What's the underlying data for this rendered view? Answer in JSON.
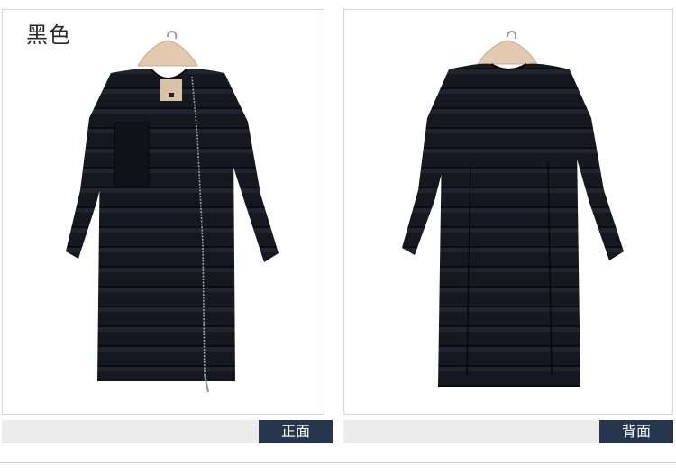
{
  "color_label": "黑色",
  "views": {
    "front": {
      "label": "正面"
    },
    "back": {
      "label": "背面"
    }
  },
  "colors": {
    "coat": "#15181f",
    "caption_tag": "#27364f",
    "caption_bar": "#ececec"
  }
}
